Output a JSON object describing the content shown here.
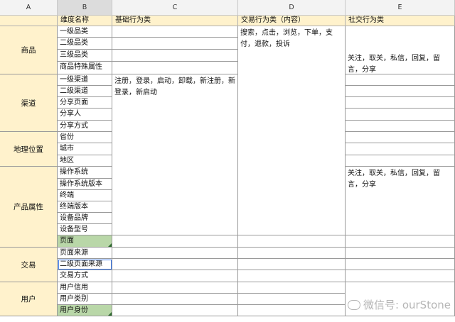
{
  "columns": [
    "A",
    "B",
    "C",
    "D",
    "E"
  ],
  "header_row": {
    "b": "维度名称",
    "c": "基础行为类",
    "d": "交易行为类（内容）",
    "e": "社交行为类"
  },
  "groups": {
    "goods": "商品",
    "channel": "渠道",
    "geo": "地理位置",
    "product": "产品属性",
    "trade": "交易",
    "user": "用户"
  },
  "items": [
    "一级品类",
    "二级品类",
    "三级品类",
    "商品特殊属性",
    "一级渠道",
    "二级渠道",
    "分享页面",
    "分享人",
    "分享方式",
    "省份",
    "城市",
    "地区",
    "操作系统",
    "操作系统版本",
    "终端",
    "终端版本",
    "设备品牌",
    "设备型号",
    "页面",
    "页面来源",
    "二级页面来源",
    "交易方式",
    "用户信用",
    "用户类别",
    "用户身份"
  ],
  "texts": {
    "basic_behaviors": "注册，登录，启动，卸载，新注册，新登录，新启动",
    "trade_behaviors": "搜索，点击，浏览，下单，支付，退款，投诉",
    "social_1": "关注，取关，私信，回复，留言，分享",
    "social_2": "关注，取关，私信，回复，留言，分享"
  },
  "watermark": "微信号: ourStone",
  "colors": {
    "header_fill": "#fff2cc",
    "green_fill": "#b9d7a8",
    "selection": "#3b78e7"
  }
}
